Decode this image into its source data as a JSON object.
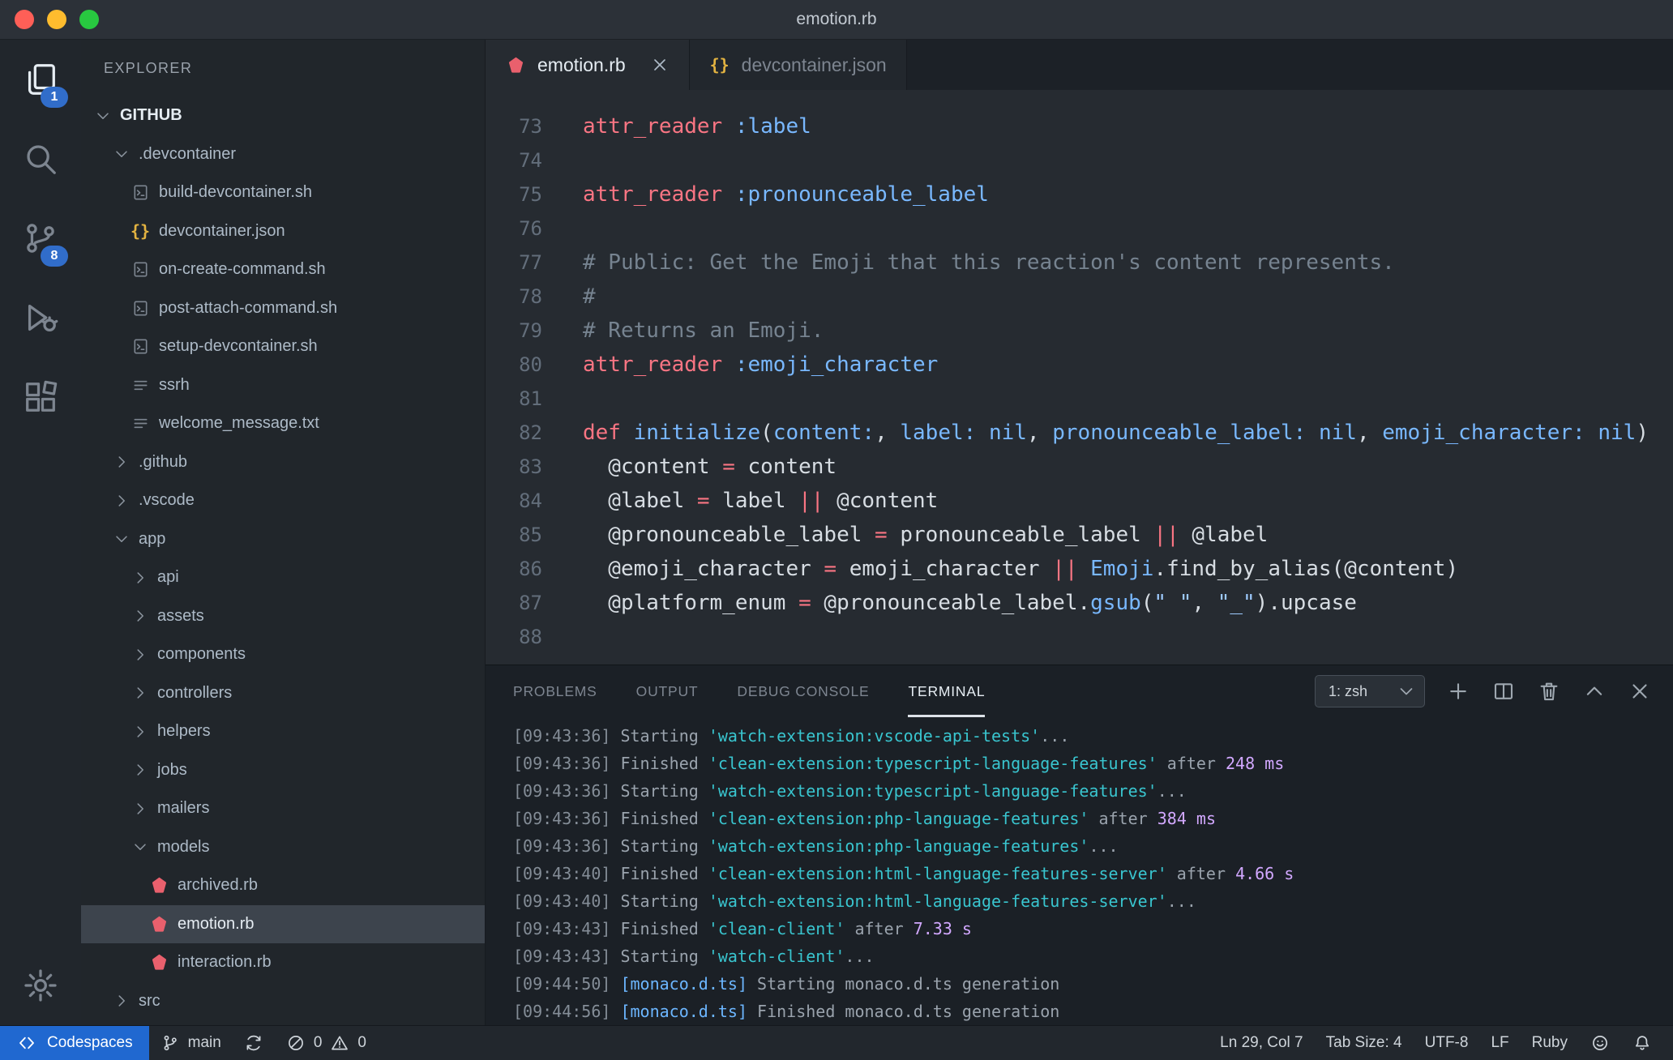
{
  "titlebar": {
    "title": "emotion.rb"
  },
  "activity_bar": {
    "items": [
      {
        "name": "explorer",
        "icon": "files-icon",
        "badge": "1",
        "active": true
      },
      {
        "name": "search",
        "icon": "search-icon"
      },
      {
        "name": "source-control",
        "icon": "source-control-icon",
        "badge": "8"
      },
      {
        "name": "run-and-debug",
        "icon": "run-debug-icon"
      },
      {
        "name": "extensions",
        "icon": "extensions-icon"
      }
    ],
    "bottom_items": [
      {
        "name": "settings",
        "icon": "settings-gear-icon"
      }
    ]
  },
  "sidebar": {
    "header": "EXPLORER",
    "section": "GITHUB",
    "tree": [
      {
        "label": ".devcontainer",
        "level": 1,
        "kind": "folder",
        "expanded": true
      },
      {
        "label": "build-devcontainer.sh",
        "level": 2,
        "kind": "file",
        "icon": "shell-file-icon"
      },
      {
        "label": "devcontainer.json",
        "level": 2,
        "kind": "file",
        "icon": "json-file-icon"
      },
      {
        "label": "on-create-command.sh",
        "level": 2,
        "kind": "file",
        "icon": "shell-file-icon"
      },
      {
        "label": "post-attach-command.sh",
        "level": 2,
        "kind": "file",
        "icon": "shell-file-icon"
      },
      {
        "label": "setup-devcontainer.sh",
        "level": 2,
        "kind": "file",
        "icon": "shell-file-icon"
      },
      {
        "label": "ssrh",
        "level": 2,
        "kind": "file",
        "icon": "text-file-icon"
      },
      {
        "label": "welcome_message.txt",
        "level": 2,
        "kind": "file",
        "icon": "text-file-icon"
      },
      {
        "label": ".github",
        "level": 1,
        "kind": "folder",
        "expanded": false
      },
      {
        "label": ".vscode",
        "level": 1,
        "kind": "folder",
        "expanded": false
      },
      {
        "label": "app",
        "level": 1,
        "kind": "folder",
        "expanded": true
      },
      {
        "label": "api",
        "level": 2,
        "kind": "folder",
        "expanded": false
      },
      {
        "label": "assets",
        "level": 2,
        "kind": "folder",
        "expanded": false
      },
      {
        "label": "components",
        "level": 2,
        "kind": "folder",
        "expanded": false
      },
      {
        "label": "controllers",
        "level": 2,
        "kind": "folder",
        "expanded": false
      },
      {
        "label": "helpers",
        "level": 2,
        "kind": "folder",
        "expanded": false
      },
      {
        "label": "jobs",
        "level": 2,
        "kind": "folder",
        "expanded": false
      },
      {
        "label": "mailers",
        "level": 2,
        "kind": "folder",
        "expanded": false
      },
      {
        "label": "models",
        "level": 2,
        "kind": "folder",
        "expanded": true
      },
      {
        "label": "archived.rb",
        "level": 3,
        "kind": "file",
        "icon": "ruby-file-icon"
      },
      {
        "label": "emotion.rb",
        "level": 3,
        "kind": "file",
        "icon": "ruby-file-icon",
        "selected": true
      },
      {
        "label": "interaction.rb",
        "level": 3,
        "kind": "file",
        "icon": "ruby-file-icon"
      },
      {
        "label": "src",
        "level": 1,
        "kind": "folder",
        "expanded": false
      }
    ]
  },
  "editor": {
    "tabs": [
      {
        "label": "emotion.rb",
        "icon": "ruby-file-icon",
        "active": true
      },
      {
        "label": "devcontainer.json",
        "icon": "json-file-icon",
        "active": false
      }
    ],
    "code_lines": [
      {
        "num": 73,
        "tokens": [
          [
            "attr_reader",
            "k"
          ],
          [
            " ",
            "p"
          ],
          [
            ":label",
            "b"
          ]
        ]
      },
      {
        "num": 74,
        "tokens": []
      },
      {
        "num": 75,
        "tokens": [
          [
            "attr_reader",
            "k"
          ],
          [
            " ",
            "p"
          ],
          [
            ":pronounceable_label",
            "b"
          ]
        ]
      },
      {
        "num": 76,
        "tokens": []
      },
      {
        "num": 77,
        "tokens": [
          [
            "# Public: Get the Emoji that this reaction's content represents.",
            "c"
          ]
        ]
      },
      {
        "num": 78,
        "tokens": [
          [
            "#",
            "c"
          ]
        ]
      },
      {
        "num": 79,
        "tokens": [
          [
            "# Returns an Emoji.",
            "c"
          ]
        ]
      },
      {
        "num": 80,
        "tokens": [
          [
            "attr_reader",
            "k"
          ],
          [
            " ",
            "p"
          ],
          [
            ":emoji_character",
            "b"
          ]
        ]
      },
      {
        "num": 81,
        "tokens": []
      },
      {
        "num": 82,
        "tokens": [
          [
            "def",
            "k"
          ],
          [
            " ",
            "p"
          ],
          [
            "initialize",
            "b"
          ],
          [
            "(",
            "p"
          ],
          [
            "content:",
            "b"
          ],
          [
            ", ",
            "p"
          ],
          [
            "label:",
            "b"
          ],
          [
            " ",
            "p"
          ],
          [
            "nil",
            "b"
          ],
          [
            ", ",
            "p"
          ],
          [
            "pronounceable_label:",
            "b"
          ],
          [
            " ",
            "p"
          ],
          [
            "nil",
            "b"
          ],
          [
            ", ",
            "p"
          ],
          [
            "emoji_character:",
            "b"
          ],
          [
            " ",
            "p"
          ],
          [
            "nil",
            "b"
          ],
          [
            ")",
            "p"
          ]
        ]
      },
      {
        "num": 83,
        "tokens": [
          [
            "  @content ",
            "p"
          ],
          [
            "=",
            "k"
          ],
          [
            " content",
            "p"
          ]
        ]
      },
      {
        "num": 84,
        "tokens": [
          [
            "  @label ",
            "p"
          ],
          [
            "=",
            "k"
          ],
          [
            " label ",
            "p"
          ],
          [
            "||",
            "k"
          ],
          [
            " @content",
            "p"
          ]
        ]
      },
      {
        "num": 85,
        "tokens": [
          [
            "  @pronounceable_label ",
            "p"
          ],
          [
            "=",
            "k"
          ],
          [
            " pronounceable_label ",
            "p"
          ],
          [
            "||",
            "k"
          ],
          [
            " @label",
            "p"
          ]
        ]
      },
      {
        "num": 86,
        "tokens": [
          [
            "  @emoji_character ",
            "p"
          ],
          [
            "=",
            "k"
          ],
          [
            " emoji_character ",
            "p"
          ],
          [
            "||",
            "k"
          ],
          [
            " ",
            "p"
          ],
          [
            "Emoji",
            "b"
          ],
          [
            ".find_by_alias(@content)",
            "p"
          ]
        ]
      },
      {
        "num": 87,
        "tokens": [
          [
            "  @platform_enum ",
            "p"
          ],
          [
            "=",
            "k"
          ],
          [
            " @pronounceable_label.",
            "p"
          ],
          [
            "gsub",
            "b"
          ],
          [
            "(",
            "p"
          ],
          [
            "\" \"",
            "s"
          ],
          [
            ", ",
            "p"
          ],
          [
            "\"_\"",
            "s"
          ],
          [
            ").upcase",
            "p"
          ]
        ]
      },
      {
        "num": 88,
        "tokens": []
      }
    ]
  },
  "panel": {
    "tabs": [
      {
        "label": "PROBLEMS"
      },
      {
        "label": "OUTPUT"
      },
      {
        "label": "DEBUG CONSOLE"
      },
      {
        "label": "TERMINAL",
        "active": true
      }
    ],
    "shell_selector": "1: zsh",
    "actions": [
      {
        "name": "new-terminal-button",
        "icon": "plus-icon"
      },
      {
        "name": "split-terminal-button",
        "icon": "split-terminal-icon"
      },
      {
        "name": "kill-terminal-button",
        "icon": "trash-icon"
      },
      {
        "name": "maximize-panel-button",
        "icon": "chevron-up-icon"
      },
      {
        "name": "close-panel-button",
        "icon": "close-icon"
      }
    ],
    "terminal_lines": [
      {
        "tokens": [
          [
            "[09:43:36] ",
            "d"
          ],
          [
            "Starting ",
            "t"
          ],
          [
            "'watch-extension:vscode-api-tests'",
            "cy"
          ],
          [
            "...",
            "t"
          ]
        ]
      },
      {
        "tokens": [
          [
            "[09:43:36] ",
            "d"
          ],
          [
            "Finished ",
            "t"
          ],
          [
            "'clean-extension:typescript-language-features'",
            "cy"
          ],
          [
            " after ",
            "t"
          ],
          [
            "248 ms",
            "mg"
          ]
        ]
      },
      {
        "tokens": [
          [
            "[09:43:36] ",
            "d"
          ],
          [
            "Starting ",
            "t"
          ],
          [
            "'watch-extension:typescript-language-features'",
            "cy"
          ],
          [
            "...",
            "t"
          ]
        ]
      },
      {
        "tokens": [
          [
            "[09:43:36] ",
            "d"
          ],
          [
            "Finished ",
            "t"
          ],
          [
            "'clean-extension:php-language-features'",
            "cy"
          ],
          [
            " after ",
            "t"
          ],
          [
            "384 ms",
            "mg"
          ]
        ]
      },
      {
        "tokens": [
          [
            "[09:43:36] ",
            "d"
          ],
          [
            "Starting ",
            "t"
          ],
          [
            "'watch-extension:php-language-features'",
            "cy"
          ],
          [
            "...",
            "t"
          ]
        ]
      },
      {
        "tokens": [
          [
            "[09:43:40] ",
            "d"
          ],
          [
            "Finished ",
            "t"
          ],
          [
            "'clean-extension:html-language-features-server'",
            "cy"
          ],
          [
            " after ",
            "t"
          ],
          [
            "4.66 s",
            "mg"
          ]
        ]
      },
      {
        "tokens": [
          [
            "[09:43:40] ",
            "d"
          ],
          [
            "Starting ",
            "t"
          ],
          [
            "'watch-extension:html-language-features-server'",
            "cy"
          ],
          [
            "...",
            "t"
          ]
        ]
      },
      {
        "tokens": [
          [
            "[09:43:43] ",
            "d"
          ],
          [
            "Finished ",
            "t"
          ],
          [
            "'clean-client'",
            "cy"
          ],
          [
            " after ",
            "t"
          ],
          [
            "7.33 s",
            "mg"
          ]
        ]
      },
      {
        "tokens": [
          [
            "[09:43:43] ",
            "d"
          ],
          [
            "Starting ",
            "t"
          ],
          [
            "'watch-client'",
            "cy"
          ],
          [
            "...",
            "t"
          ]
        ]
      },
      {
        "tokens": [
          [
            "[09:44:50] ",
            "d"
          ],
          [
            "[monaco.d.ts]",
            "bl"
          ],
          [
            " Starting monaco.d.ts generation",
            "t"
          ]
        ]
      },
      {
        "tokens": [
          [
            "[09:44:56] ",
            "d"
          ],
          [
            "[monaco.d.ts]",
            "bl"
          ],
          [
            " Finished monaco.d.ts generation",
            "t"
          ]
        ]
      }
    ]
  },
  "status_bar": {
    "remote": "Codespaces",
    "branch": "main",
    "errors": "0",
    "warnings": "0",
    "cursor": "Ln 29, Col 7",
    "indent": "Tab Size: 4",
    "encoding": "UTF-8",
    "eol": "LF",
    "language": "Ruby"
  },
  "colors": {
    "badge_blue": "#316dca",
    "remote_blue": "#2068d0",
    "ruby_icon": "#e9606d",
    "json_icon": "#e3b341",
    "syntax_keyword": "#f97583",
    "syntax_symbol": "#79b8ff",
    "syntax_string": "#9ecbff",
    "syntax_comment": "#768390",
    "terminal_cyan": "#39c5cf",
    "terminal_purple": "#d2a8ff",
    "terminal_blue": "#6cb6ff"
  }
}
